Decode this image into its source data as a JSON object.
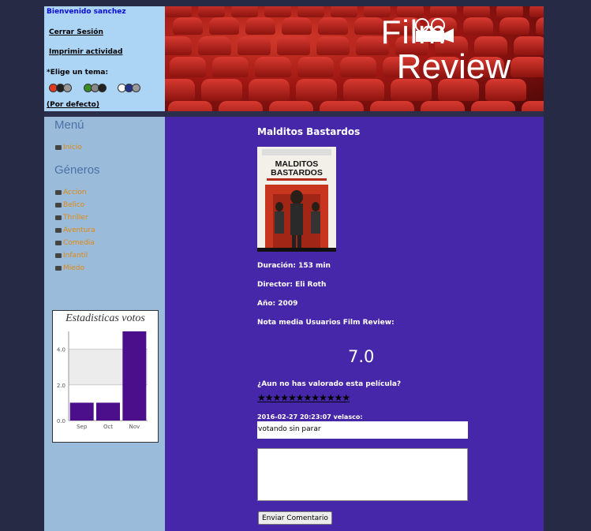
{
  "user_panel": {
    "welcome": "Bienvenido sanchez",
    "logout": "Cerrar Sesión",
    "print": "Imprimir actividad",
    "theme_label": "*Elige un tema:",
    "themes": [
      {
        "name": "red",
        "colors": [
          "#e03a20",
          "#222222",
          "#999999"
        ]
      },
      {
        "name": "green",
        "colors": [
          "#3a8a24",
          "#888888",
          "#222222"
        ]
      },
      {
        "name": "blue",
        "colors": [
          "#ffffff",
          "#22338a",
          "#999999"
        ]
      }
    ],
    "default_theme": "(Por defecto)"
  },
  "banner": {
    "logo_line1": "Film",
    "logo_line2": "Review"
  },
  "sidebar": {
    "menu_title": "Menú",
    "menu_items": [
      "Inicio"
    ],
    "genres_title": "Géneros",
    "genres": [
      "Accion",
      "Belico",
      "Thriller",
      "Aventura",
      "Comedia",
      "Infantil",
      "Miedo"
    ],
    "stats_title": "Estadisticas votos"
  },
  "chart_data": {
    "type": "bar",
    "title": "Estadisticas votos",
    "categories": [
      "Sep",
      "Oct",
      "Nov"
    ],
    "values": [
      1,
      1,
      5
    ],
    "yticks": [
      "0.0",
      "2.0",
      "4.0"
    ],
    "ylim": [
      0,
      5
    ],
    "bar_color": "#4b0f8c"
  },
  "movie": {
    "title": "Malditos Bastardos",
    "poster_title": "MALDITOS BASTARDOS",
    "duration": "Duración: 153 min",
    "director": "Director: Eli Roth",
    "year": "Año: 2009",
    "rating_label": "Nota media Usuarios Film Review:",
    "rating": "7.0",
    "rate_question": "¿Aun no has valorado esta película?",
    "stars": "★★★★★★★★★★★★"
  },
  "comments": {
    "meta": "2016-02-27 20:23:07 velasco:",
    "text": "votando sin parar",
    "input_value": "",
    "send_label": "Enviar Comentario"
  },
  "colors": {
    "main_bg": "#4727a9",
    "sidebar_bg": "#9bbbda",
    "user_panel_bg": "#abd4f5",
    "page_bg": "#262a45",
    "accent_link": "#e28a0c"
  }
}
